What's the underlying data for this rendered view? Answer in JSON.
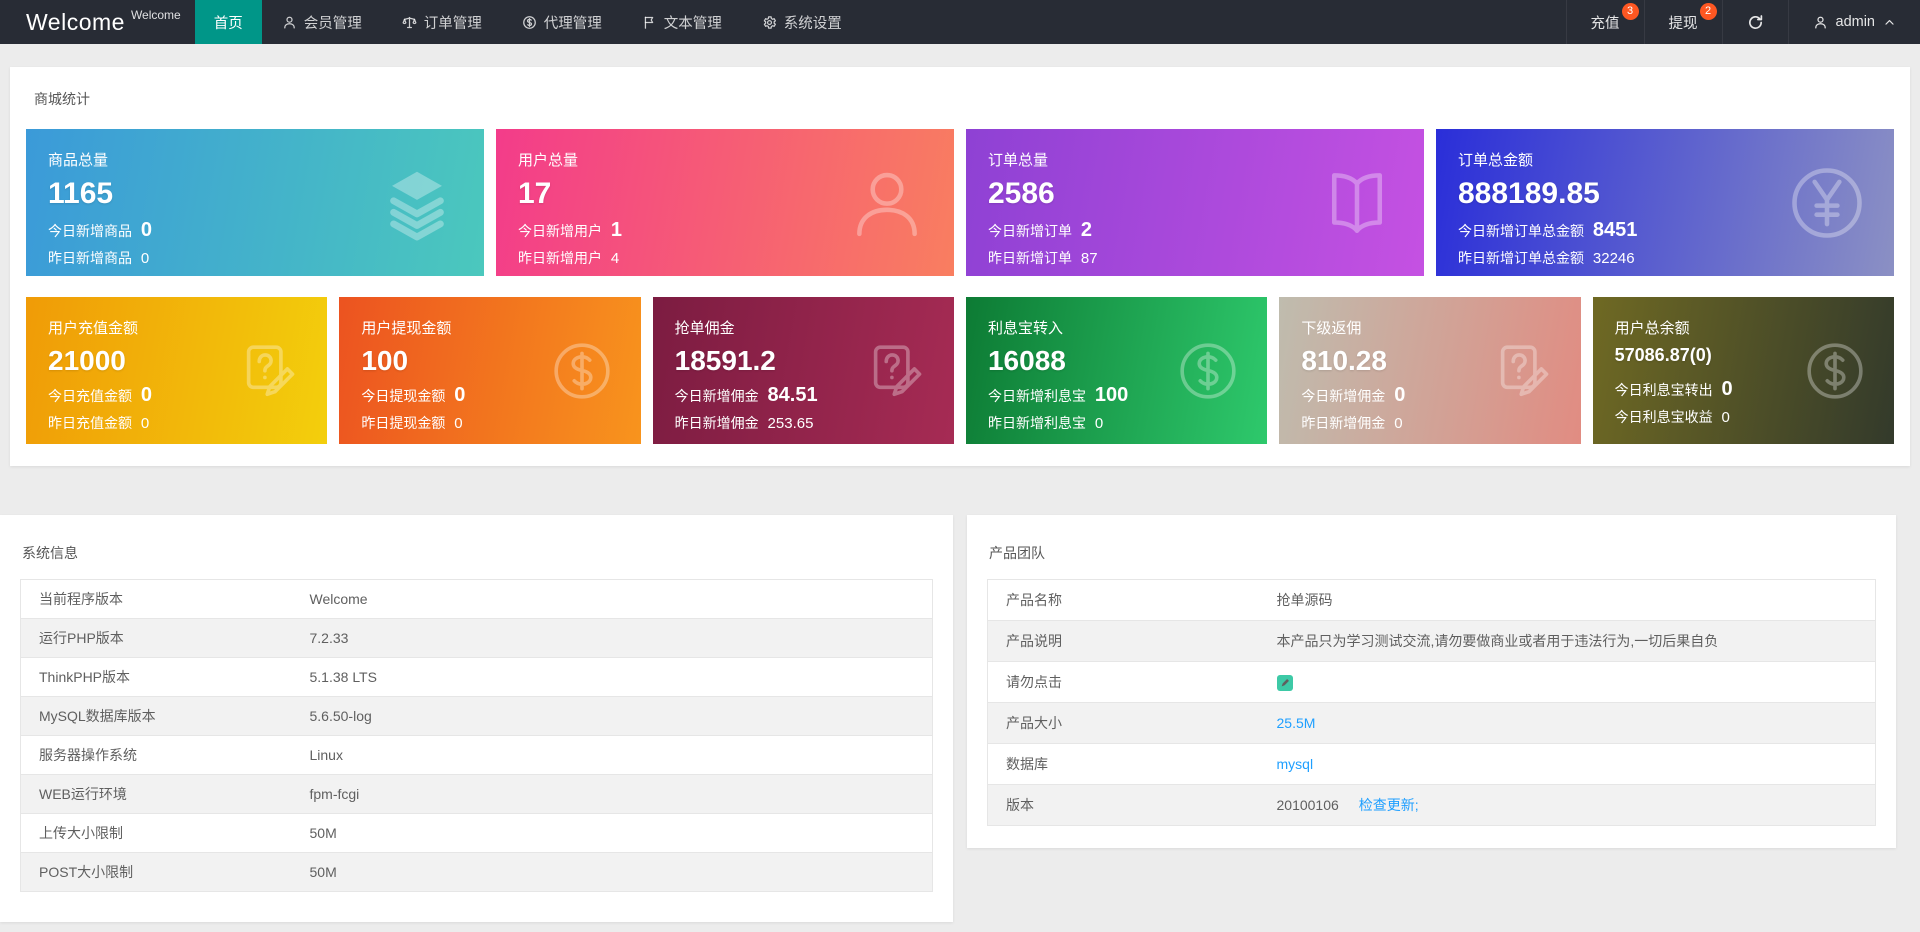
{
  "colors": {
    "accent": "#009688",
    "badge": "#FF5722",
    "link": "#1E9FFF",
    "pen_badge": "#3DC9A6"
  },
  "brand": {
    "name": "Welcome",
    "superscript": "Welcome"
  },
  "nav": {
    "items": [
      {
        "label": "首页",
        "active": true
      },
      {
        "label": "会员管理",
        "icon": "user"
      },
      {
        "label": "订单管理",
        "icon": "scales"
      },
      {
        "label": "代理管理",
        "icon": "dollar"
      },
      {
        "label": "文本管理",
        "icon": "flag"
      },
      {
        "label": "系统设置",
        "icon": "gear"
      }
    ],
    "right": {
      "recharge": {
        "label": "充值",
        "badge": "3"
      },
      "withdraw": {
        "label": "提现",
        "badge": "2"
      },
      "user": {
        "name": "admin"
      }
    }
  },
  "stats": {
    "title": "商城统计",
    "cards": [
      {
        "row": 1,
        "title": "商品总量",
        "value": "1165",
        "today_label": "今日新增商品",
        "today_value": "0",
        "yesterday_label": "昨日新增商品",
        "yesterday_value": "0",
        "icon": "layers",
        "gradient": [
          "#3B9AD9",
          "#4BC8BD"
        ]
      },
      {
        "row": 1,
        "title": "用户总量",
        "value": "17",
        "today_label": "今日新增用户",
        "today_value": "1",
        "yesterday_label": "昨日新增用户",
        "yesterday_value": "4",
        "icon": "user-outline",
        "gradient": [
          "#F33C8A",
          "#F97E60"
        ]
      },
      {
        "row": 1,
        "title": "订单总量",
        "value": "2586",
        "today_label": "今日新增订单",
        "today_value": "2",
        "yesterday_label": "昨日新增订单",
        "yesterday_value": "87",
        "icon": "open-book",
        "gradient": [
          "#8E41D4",
          "#C551E2"
        ]
      },
      {
        "row": 1,
        "title": "订单总金额",
        "value": "888189.85",
        "today_label": "今日新增订单总金额",
        "today_value": "8451",
        "yesterday_label": "昨日新增订单总金额",
        "yesterday_value": "32246",
        "icon": "yen-circle",
        "gradient": [
          "#2A2ED9",
          "#8B90C4"
        ]
      },
      {
        "row": 2,
        "title": "用户充值金额",
        "value": "21000",
        "today_label": "今日充值金额",
        "today_value": "0",
        "yesterday_label": "昨日充值金额",
        "yesterday_value": "0",
        "icon": "question-edit",
        "gradient": [
          "#F09B07",
          "#F3CF0C"
        ]
      },
      {
        "row": 2,
        "title": "用户提现金额",
        "value": "100",
        "today_label": "今日提现金额",
        "today_value": "0",
        "yesterday_label": "昨日提现金额",
        "yesterday_value": "0",
        "icon": "dollar-circle",
        "gradient": [
          "#EC5320",
          "#F8941D"
        ]
      },
      {
        "row": 2,
        "title": "抢单佣金",
        "value": "18591.2",
        "today_label": "今日新增佣金",
        "today_value": "84.51",
        "yesterday_label": "昨日新增佣金",
        "yesterday_value": "253.65",
        "icon": "question-edit",
        "gradient": [
          "#7C1C41",
          "#A62B54"
        ]
      },
      {
        "row": 2,
        "title": "利息宝转入",
        "value": "16088",
        "today_label": "今日新增利息宝",
        "today_value": "100",
        "yesterday_label": "昨日新增利息宝",
        "yesterday_value": "0",
        "icon": "dollar-circle",
        "gradient": [
          "#0D7B34",
          "#2EC96C"
        ]
      },
      {
        "row": 2,
        "title": "下级返佣",
        "value": "810.28",
        "today_label": "今日新增佣金",
        "today_value": "0",
        "yesterday_label": "昨日新增佣金",
        "yesterday_value": "0",
        "icon": "question-edit",
        "gradient": [
          "#BFBCAE",
          "#E18C82"
        ]
      },
      {
        "row": 2,
        "title": "用户总余额",
        "value": "57086.87(0)",
        "compact": true,
        "today_label": "今日利息宝转出",
        "today_value": "0",
        "yesterday_label": "今日利息宝收益",
        "yesterday_value": "0",
        "icon": "dollar-circle",
        "gradient": [
          "#6F6923",
          "#333A2B"
        ]
      }
    ]
  },
  "system_info": {
    "title": "系统信息",
    "rows": [
      {
        "label": "当前程序版本",
        "value": "Welcome"
      },
      {
        "label": "运行PHP版本",
        "value": "7.2.33"
      },
      {
        "label": "ThinkPHP版本",
        "value": "5.1.38 LTS"
      },
      {
        "label": "MySQL数据库版本",
        "value": "5.6.50-log"
      },
      {
        "label": "服务器操作系统",
        "value": "Linux"
      },
      {
        "label": "WEB运行环境",
        "value": "fpm-fcgi"
      },
      {
        "label": "上传大小限制",
        "value": "50M"
      },
      {
        "label": "POST大小限制",
        "value": "50M"
      }
    ]
  },
  "product_team": {
    "title": "产品团队",
    "rows": [
      {
        "label": "产品名称",
        "value": "抢单源码",
        "type": "text"
      },
      {
        "label": "产品说明",
        "value": "本产品只为学习测试交流,请勿要做商业或者用于违法行为,一切后果自负",
        "type": "text"
      },
      {
        "label": "请勿点击",
        "type": "icon"
      },
      {
        "label": "产品大小",
        "value": "25.5M",
        "type": "link"
      },
      {
        "label": "数据库",
        "value": "mysql",
        "type": "link"
      },
      {
        "label": "版本",
        "value": "20100106",
        "link_label": "检查更新;",
        "type": "version"
      }
    ]
  }
}
